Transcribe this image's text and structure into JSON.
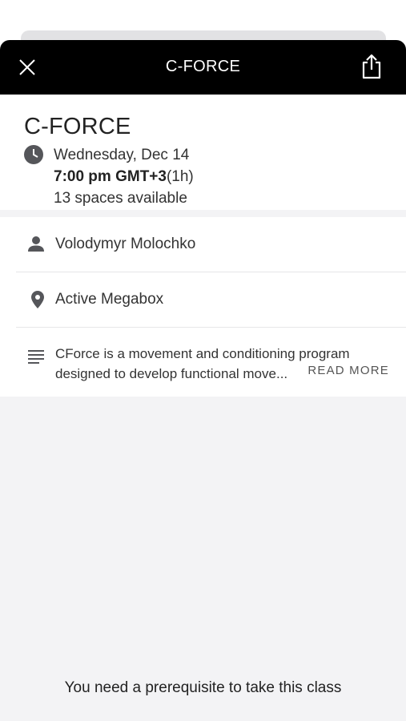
{
  "header": {
    "title": "C-FORCE",
    "close_icon": "close-icon",
    "share_icon": "share-icon"
  },
  "class_info": {
    "title": "C-FORCE",
    "date": "Wednesday, Dec 14",
    "time": "7:00 pm GMT+3",
    "duration": "(1h)",
    "spaces": "13 spaces available"
  },
  "details": {
    "instructor": "Volodymyr Molochko",
    "location": "Active Megabox",
    "description_line1": "CForce is a movement and conditioning program",
    "description_line2": "designed to develop functional move...",
    "read_more": "READ MORE"
  },
  "footer": {
    "prerequisite": "You need a prerequisite to take this class"
  },
  "colors": {
    "header_bg": "#000000",
    "sheet_bg": "#f3f3f5",
    "icon_gray": "#55565a"
  }
}
